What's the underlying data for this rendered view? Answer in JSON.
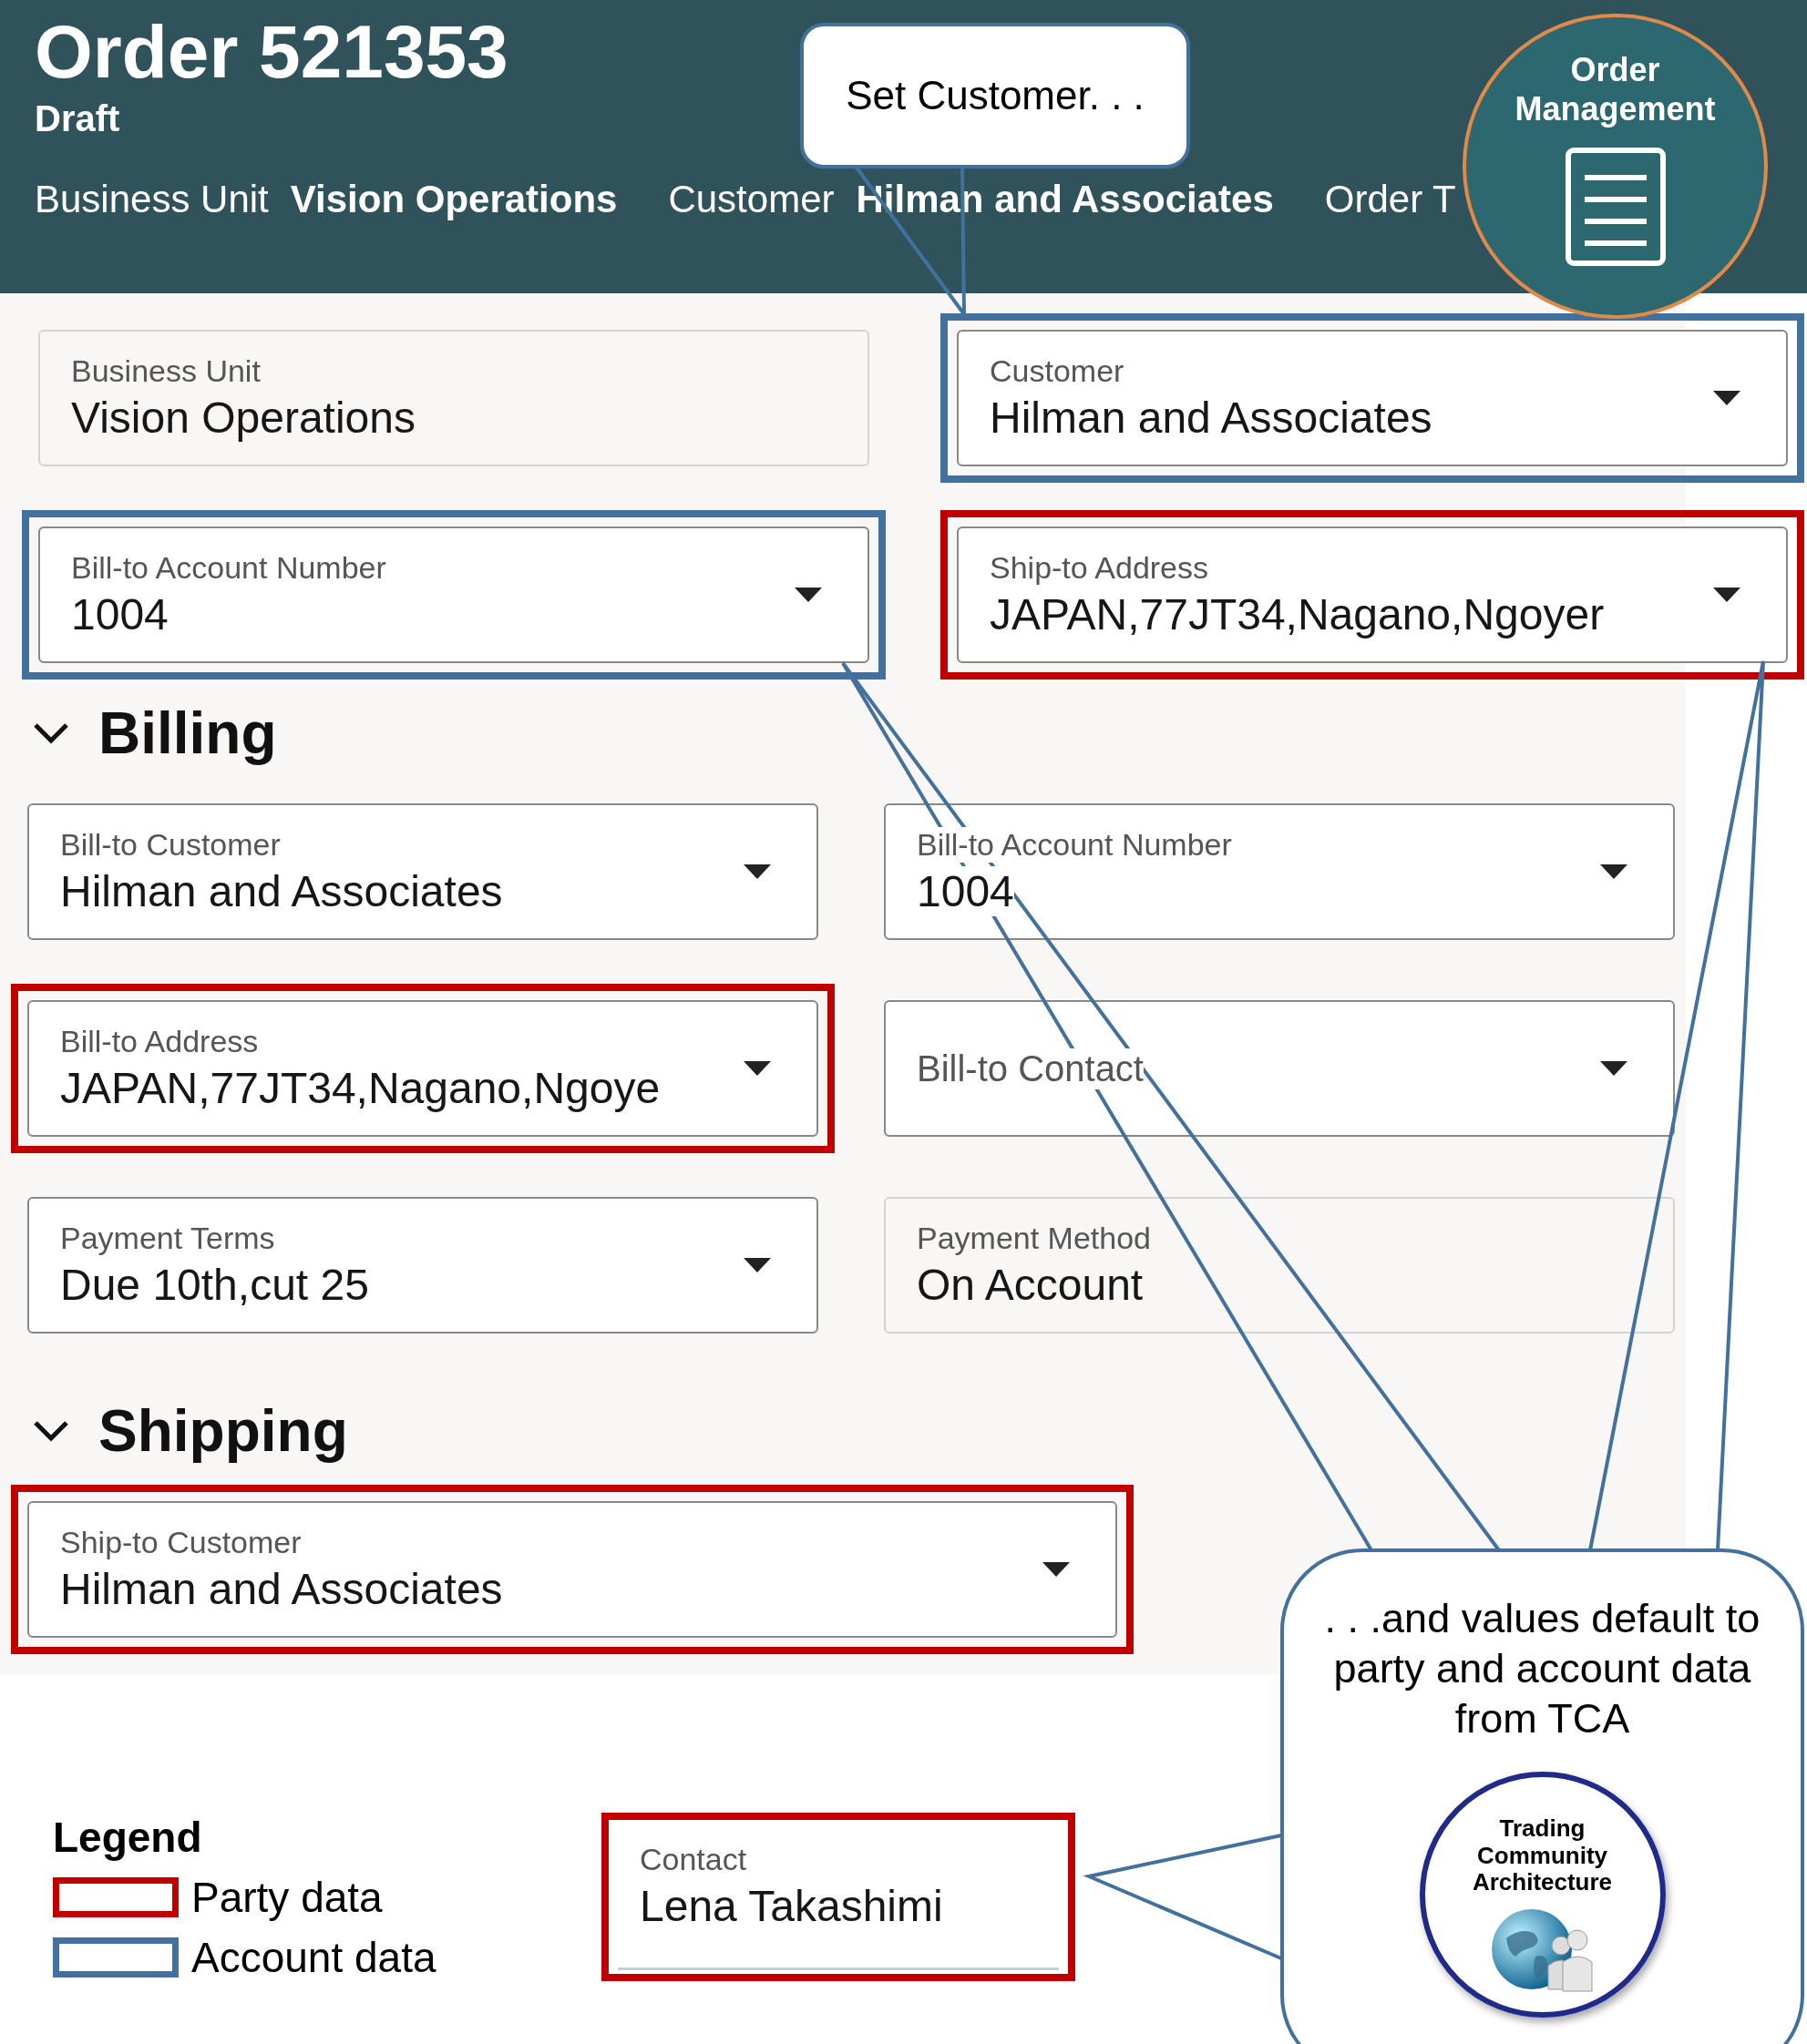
{
  "header": {
    "title": "Order 521353",
    "status": "Draft",
    "summary": [
      {
        "label": "Business Unit",
        "value": "Vision Operations"
      },
      {
        "label": "Customer",
        "value": "Hilman and Associates"
      },
      {
        "label": "Order T"
      }
    ],
    "badge": "Order Management"
  },
  "top_fields": [
    {
      "label": "Business Unit",
      "value": "Vision Operations",
      "dropdown": false,
      "party_data": false,
      "account_data": false
    },
    {
      "label": "Customer",
      "value": "Hilman and Associates",
      "dropdown": true,
      "party_data": false,
      "account_data": true
    },
    {
      "label": "Bill-to Account Number",
      "value": "1004",
      "dropdown": true,
      "party_data": false,
      "account_data": true
    },
    {
      "label": "Ship-to Address",
      "value": "JAPAN,77JT34,Nagano,Ngoyer",
      "dropdown": true,
      "party_data": true,
      "account_data": false
    }
  ],
  "sections": [
    {
      "title": "Billing",
      "expanded": true,
      "fields": [
        {
          "label": "Bill-to Customer",
          "value": "Hilman and Associates",
          "dropdown": true,
          "party_data": false,
          "account_data": false
        },
        {
          "label": "Bill-to Account Number",
          "value": "1004",
          "dropdown": true,
          "party_data": false,
          "account_data": false
        },
        {
          "label": "Bill-to Address",
          "value": "JAPAN,77JT34,Nagano,Ngoye",
          "dropdown": true,
          "party_data": true,
          "account_data": false
        },
        {
          "label": "Bill-to Contact",
          "dropdown": true,
          "party_data": false,
          "account_data": false
        },
        {
          "label": "Payment Terms",
          "value": "Due 10th,cut 25",
          "dropdown": true,
          "party_data": false,
          "account_data": false
        },
        {
          "label": "Payment Method",
          "value": "On Account",
          "dropdown": false,
          "party_data": false,
          "account_data": false
        }
      ]
    },
    {
      "title": "Shipping",
      "expanded": true,
      "fields": [
        {
          "label": "Ship-to Customer",
          "value": "Hilman and Associates",
          "dropdown": true,
          "party_data": true,
          "account_data": false
        }
      ]
    }
  ],
  "legend": {
    "title": "Legend",
    "items": [
      {
        "label": "Party data",
        "kind": "party"
      },
      {
        "label": "Account data",
        "kind": "account"
      }
    ]
  },
  "contact": {
    "label": "Contact",
    "value": "Lena Takashimi",
    "party_data": true
  },
  "callouts": [
    {
      "text": "Set Customer. . ."
    },
    {
      "text": ". . .and values default to party and account data from TCA"
    }
  ],
  "tca": {
    "title": "Trading Community Architecture"
  }
}
